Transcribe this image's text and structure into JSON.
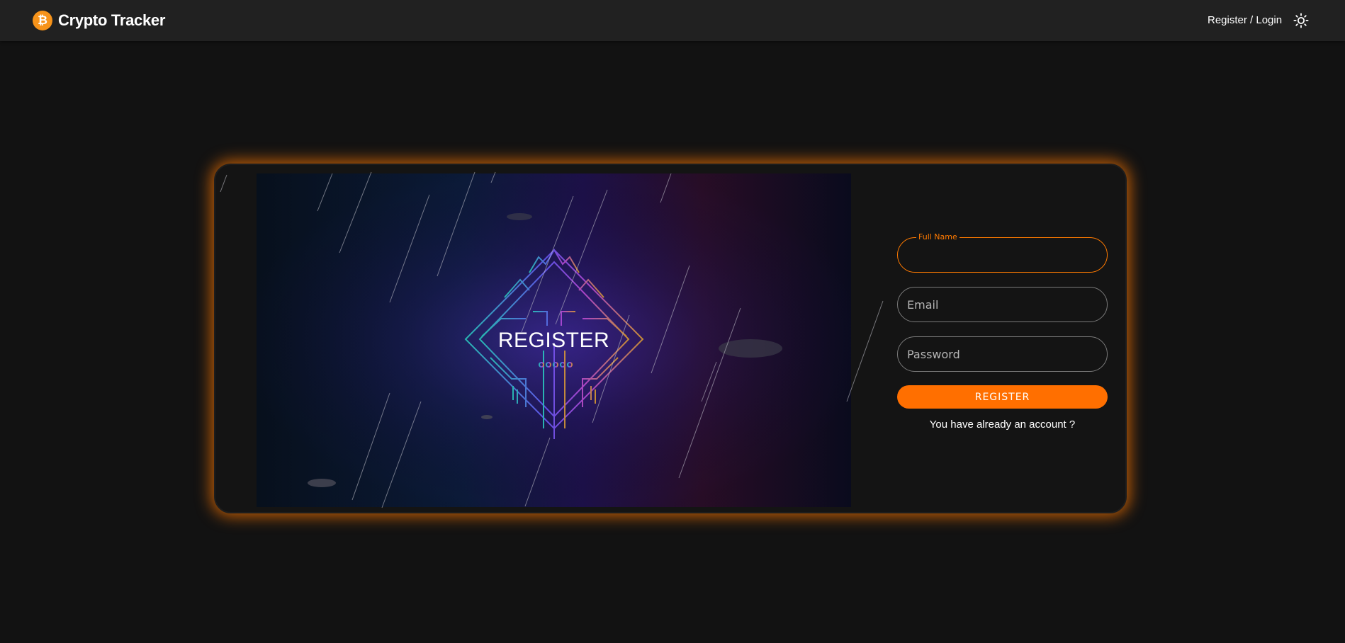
{
  "header": {
    "brand_icon": "bitcoin-icon",
    "brand_title": "Crypto Tracker",
    "nav_link": "Register / Login",
    "theme_icon": "sun-icon"
  },
  "hero": {
    "title": "REGISTER"
  },
  "form": {
    "full_name_label": "Full Name",
    "full_name_value": "",
    "email_placeholder": "Email",
    "password_placeholder": "Password",
    "submit_label": "REGISTER",
    "login_link": "You have already an account ?"
  },
  "colors": {
    "accent": "#ff6f00",
    "background": "#121212",
    "header": "#212121",
    "brand_icon": "#f7931a"
  }
}
